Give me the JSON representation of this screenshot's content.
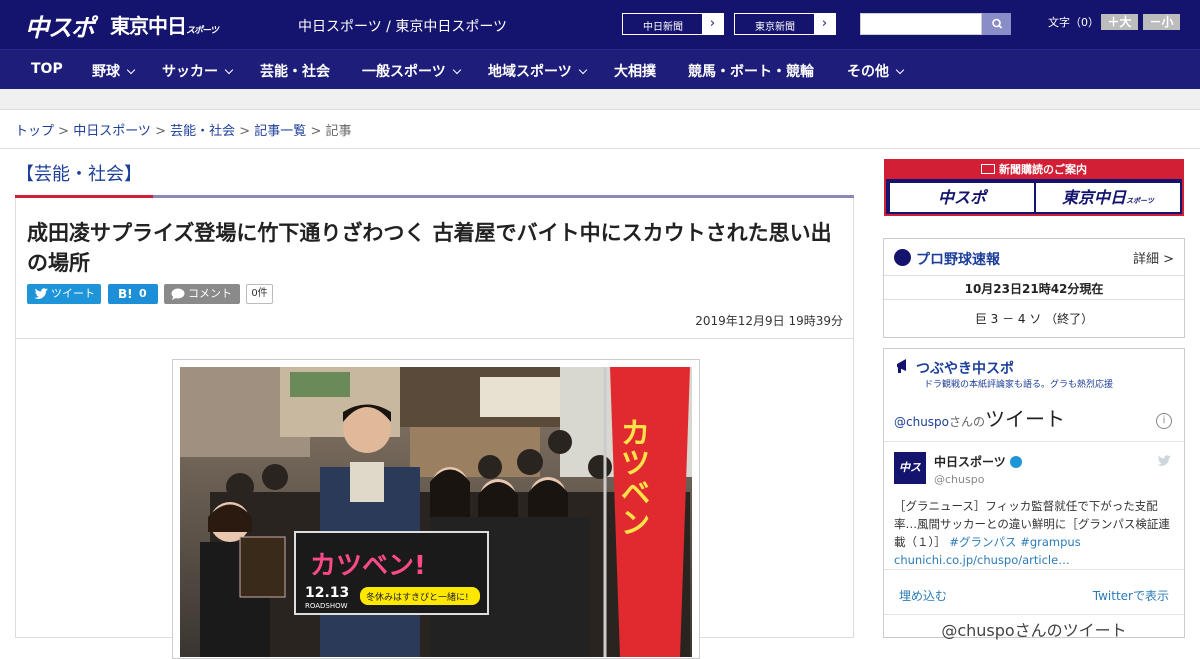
{
  "header": {
    "logo_chuspo": "中スポ",
    "logo_tokyo": "東京中日",
    "logo_tokyo_sub": "スポーツ",
    "site_name": "中日スポーツ / 東京中日スポーツ",
    "ext_links": [
      "中日新聞",
      "東京新聞"
    ],
    "font_label": "文字（0）",
    "font_larger": "＋大",
    "font_smaller": "－小"
  },
  "nav": [
    "TOP",
    "野球",
    "サッカー",
    "芸能・社会",
    "一般スポーツ",
    "地域スポーツ",
    "大相撲",
    "競馬・ボート・競輪",
    "その他"
  ],
  "breadcrumb": [
    "トップ",
    "中日スポーツ",
    "芸能・社会",
    "記事一覧",
    "記事"
  ],
  "article": {
    "category": "【芸能・社会】",
    "headline": "成田凌サプライズ登場に竹下通りざわつく 古着屋でバイト中にスカウトされた思い出の場所",
    "tweet_label": "ツイート",
    "hatebu_label": "B!",
    "hatebu_count": "0",
    "comment_label": "コメント",
    "comment_count": "0件",
    "date": "2019年12月9日 19時39分",
    "photo_banner": "カツベン!",
    "photo_date": "12.13",
    "photo_roadshow": "ROADSHOW",
    "photo_sub": "冬休みはすきぴと一緒に!",
    "photo_flag": "カツベン"
  },
  "sidebar": {
    "subscribe_header": "新聞購読のご案内",
    "subscribe_chuspo": "中スポ",
    "subscribe_tokyo": "東京中日",
    "subscribe_tokyo_sub": "スポーツ",
    "baseball_title": "プロ野球速報",
    "baseball_detail": "詳細 >",
    "baseball_time": "10月23日21時42分現在",
    "baseball_score": "巨 3 － 4 ソ （終了）",
    "twitter_title": "つぶやき中スポ",
    "twitter_sub": "ドラ観戦の本紙評論家も語る。グラも熱烈応援",
    "tw_handle_prefix": "@chuspo",
    "tw_handle_suffix": "さんの",
    "tw_tweet_word": "ツイート",
    "tw_account_name": "中日スポーツ",
    "tw_account_handle": "@chuspo",
    "tw_text": "［グラニュース］フィッカ監督就任で下がった支配率…風間サッカーとの違い鮮明に［グランパス検証連載（１）］",
    "tw_tag1": "#グランパス",
    "tw_tag2": "#grampus",
    "tw_link": "chunichi.co.jp/chuspo/article…",
    "tw_embed": "埋め込む",
    "tw_view": "Twitterで表示",
    "tw_footer": "@chuspoさんのツイート",
    "avatar_text": "中スポ"
  }
}
